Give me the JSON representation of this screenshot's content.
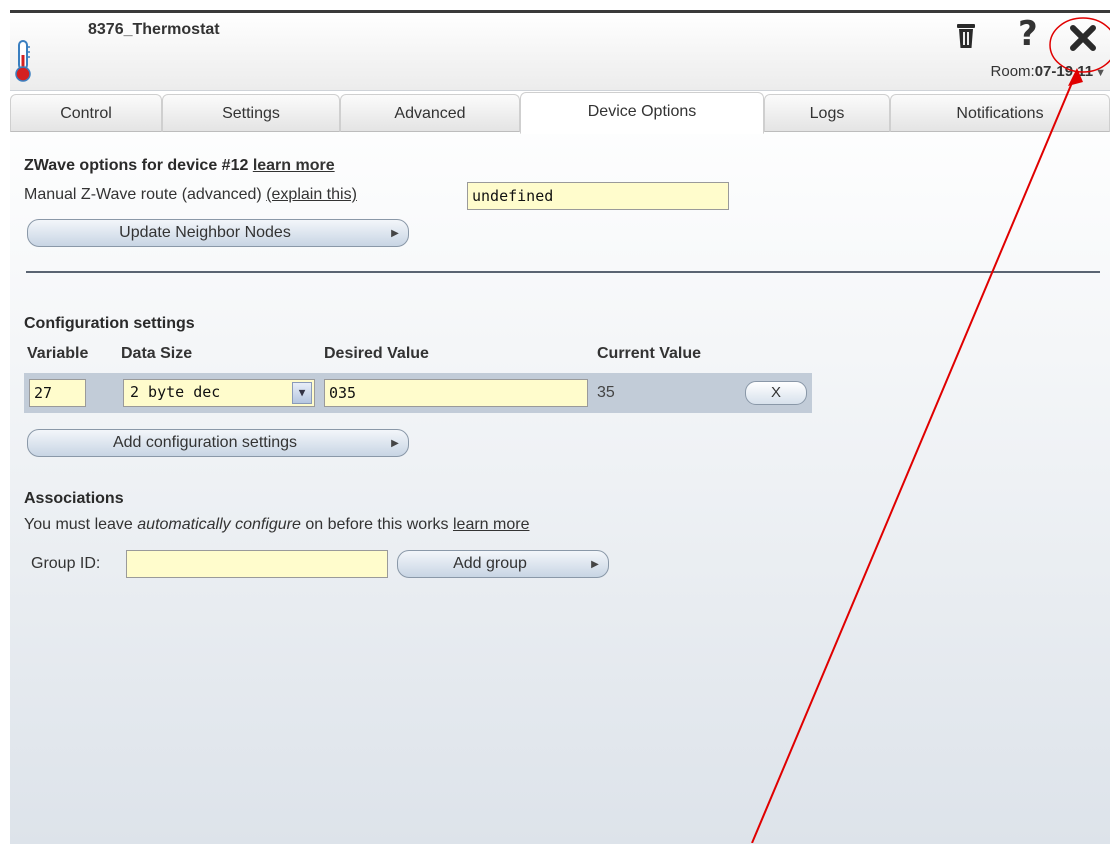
{
  "device": {
    "title": "8376_Thermostat",
    "icon": "thermometer-icon"
  },
  "header": {
    "room_label": "Room:",
    "room_value": "07-19 11",
    "icons": [
      "trash-icon",
      "help-icon",
      "close-icon"
    ],
    "help_glyph": "?"
  },
  "tabs": [
    {
      "label": "Control"
    },
    {
      "label": "Settings"
    },
    {
      "label": "Advanced"
    },
    {
      "label": "Device Options",
      "active": true
    },
    {
      "label": "Logs"
    },
    {
      "label": "Notifications"
    }
  ],
  "zwave": {
    "title": "ZWave options for device #12",
    "learn_more": "learn more",
    "route_label": "Manual Z-Wave route (advanced)",
    "explain": "(explain this)",
    "route_value": "undefined",
    "update_button": "Update Neighbor Nodes"
  },
  "config": {
    "title": "Configuration settings",
    "headers": {
      "variable": "Variable",
      "data_size": "Data Size",
      "desired": "Desired Value",
      "current": "Current Value"
    },
    "row": {
      "variable": "27",
      "data_size": "2 byte dec",
      "desired": "035",
      "current": "35",
      "remove": "X"
    },
    "add_button": "Add configuration settings"
  },
  "associations": {
    "title": "Associations",
    "note_prefix": "You must leave ",
    "note_em": "automatically configure",
    "note_suffix": " on before this works ",
    "learn_more": "learn more",
    "group_label": "Group ID:",
    "group_value": "",
    "add_group": "Add group"
  },
  "colors": {
    "annotation": "#e00000",
    "input_bg": "#fffccc",
    "row_bg": "#c2ccd8"
  }
}
